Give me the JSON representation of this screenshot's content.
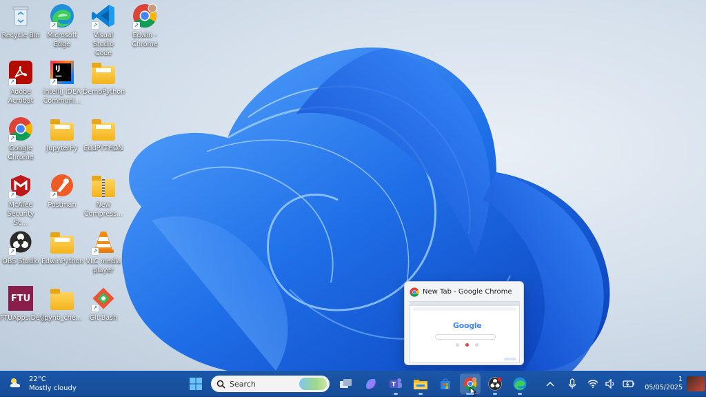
{
  "desktop": {
    "icons": [
      {
        "label": "Recycle Bin"
      },
      {
        "label": "Microsoft\nEdge"
      },
      {
        "label": "Visual Studio\nCode"
      },
      {
        "label": "Edwin -\nChrome"
      },
      {
        "label": "Adobe\nAcrobat"
      },
      {
        "label": "IntelliJ IDEA\nCommuni..."
      },
      {
        "label": "DemoPython"
      },
      {
        "label": "Google\nChrome"
      },
      {
        "label": "JupyterPy"
      },
      {
        "label": "EddPYTHON"
      },
      {
        "label": "McAfee\nSecurity Sc..."
      },
      {
        "label": "Postman"
      },
      {
        "label": "New\nCompress..."
      },
      {
        "label": "OBS Studio"
      },
      {
        "label": "EdwinPython"
      },
      {
        "label": "VLC media\nplayer"
      },
      {
        "label": "FTUApps.Dev"
      },
      {
        "label": "Jpynb_che..."
      },
      {
        "label": "Git Bash"
      }
    ]
  },
  "preview": {
    "title": "New Tab - Google Chrome",
    "thumb_logo": "Google"
  },
  "taskbar": {
    "weather_temp": "22°C",
    "weather_desc": "Mostly cloudy",
    "search_label": "Search",
    "date": "05/05/2025",
    "time": "1"
  },
  "colors": {
    "taskbar": "#1a56a8",
    "accent": "#1a6fff"
  }
}
